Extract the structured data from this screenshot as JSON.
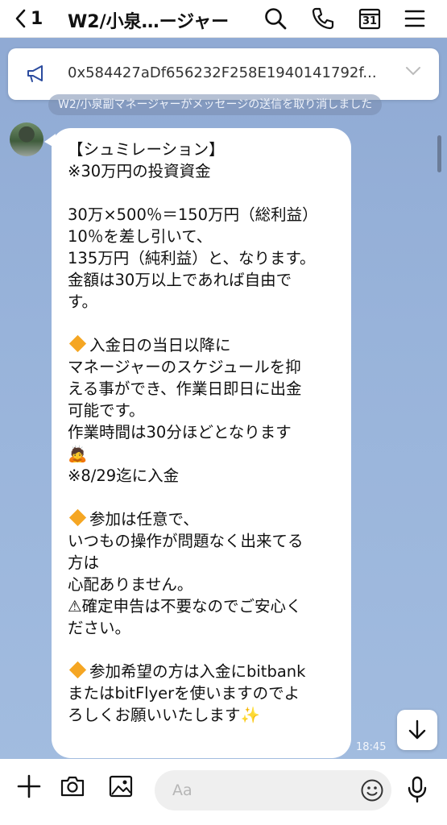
{
  "header": {
    "unread_count": "1",
    "title": "W2/小泉…ージャー",
    "calendar_day": "31"
  },
  "pinned": {
    "text": "0x584427aDf656232F258E1940141792f..."
  },
  "notice": {
    "text": "W2/小泉副マネージャーがメッセージの送信を取り消しました"
  },
  "message": {
    "lines": [
      "【シュミレーション】",
      "※30万円の投資資金",
      "",
      "30万×500％＝150万円（総利益）",
      "10％を差し引いて、",
      "135万円（純利益）と、なります。",
      "金額は30万以上であれば自由で",
      "す。",
      "",
      "◆入金日の当日以降に",
      "マネージャーのスケジュールを抑",
      "える事ができ、作業日即日に出金",
      "可能です。",
      "作業時間は30分ほどとなります",
      "🙇",
      "※8/29迄に入金",
      "",
      "◆参加は任意で、",
      "いつもの操作が問題なく出来てる",
      "方は",
      "心配ありません。",
      "⚠確定申告は不要なのでご安心く",
      "ださい。",
      "",
      "◆参加希望の方は入金にbitbank",
      "またはbitFlyerを使いますのでよ",
      "ろしくお願いいたします✨"
    ],
    "time": "18:45"
  },
  "input": {
    "placeholder": "Aa"
  },
  "colors": {
    "background": "#98b3da",
    "bubble": "#ffffff",
    "diamond": "#f5a623"
  },
  "icons": [
    "back-chevron-icon",
    "search-icon",
    "phone-icon",
    "calendar-icon",
    "menu-icon",
    "megaphone-icon",
    "chevron-down-icon",
    "scroll-down-arrow-icon",
    "plus-icon",
    "camera-icon",
    "image-icon",
    "emoji-icon",
    "mic-icon"
  ]
}
